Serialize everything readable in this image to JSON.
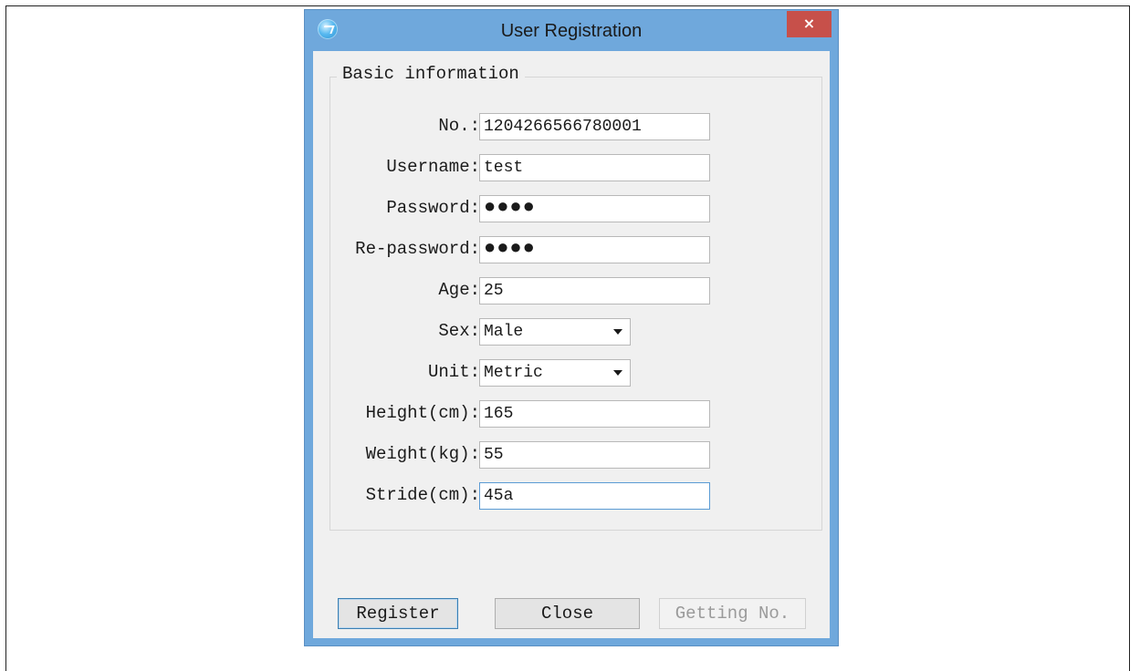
{
  "window": {
    "title": "User Registration",
    "close_glyph": "×",
    "app_icon": "app-icon"
  },
  "group": {
    "legend": "Basic information"
  },
  "fields": {
    "number": {
      "label": "No.:",
      "value": "1204266566780001"
    },
    "username": {
      "label": "Username:",
      "value": "test"
    },
    "password": {
      "label": "Password:",
      "value": "●●●●"
    },
    "repassword": {
      "label": "Re-password:",
      "value": "●●●●"
    },
    "age": {
      "label": "Age:",
      "value": "25"
    },
    "sex": {
      "label": "Sex:",
      "value": "Male"
    },
    "unit": {
      "label": "Unit:",
      "value": "Metric"
    },
    "height": {
      "label": "Height(cm):",
      "value": "165"
    },
    "weight": {
      "label": "Weight(kg):",
      "value": "55"
    },
    "stride": {
      "label": "Stride(cm):",
      "value": "45a"
    }
  },
  "buttons": {
    "register": "Register",
    "close": "Close",
    "getting_no": "Getting No."
  },
  "colors": {
    "title_bar": "#6fa8dc",
    "close_button": "#c7504a",
    "client_background": "#f0f0f0"
  }
}
